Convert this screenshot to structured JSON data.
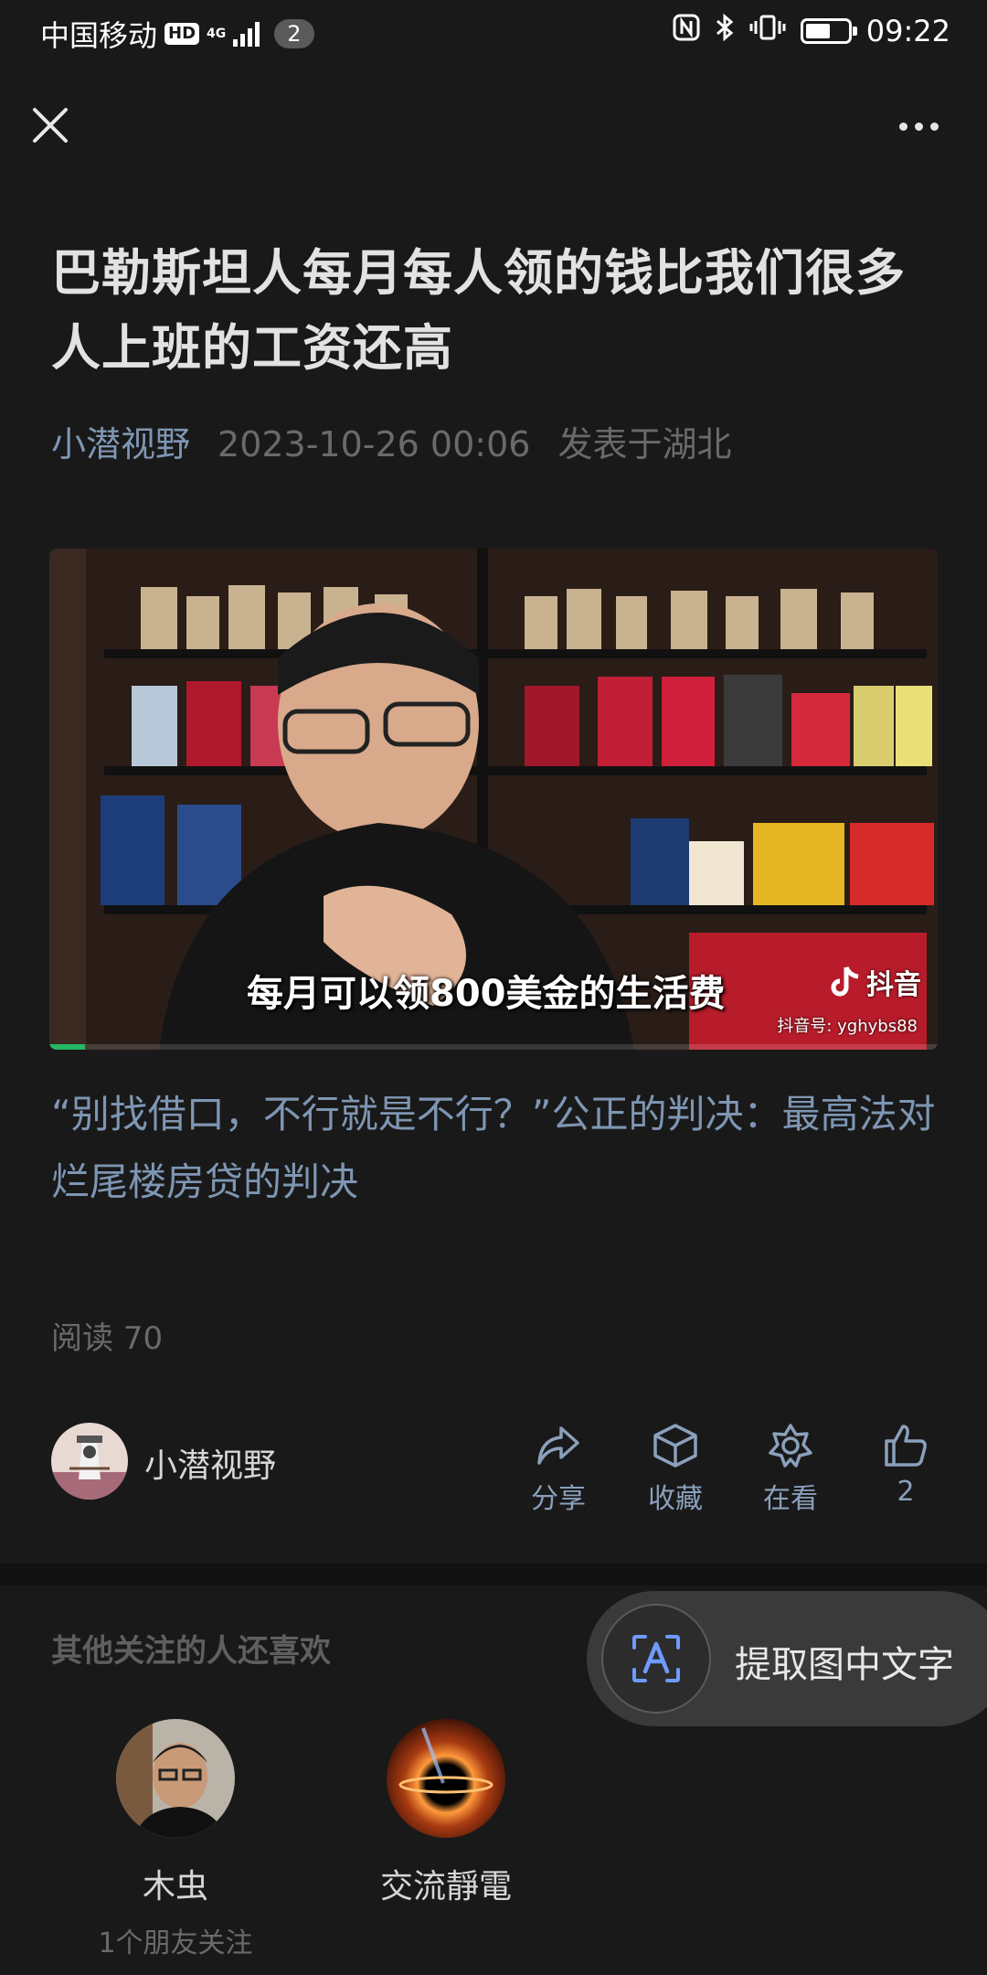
{
  "status_bar": {
    "carrier": "中国移动",
    "hd": "HD",
    "network": "4G",
    "badge": "2",
    "nfc": "N",
    "time": "09:22"
  },
  "article": {
    "title": "巴勒斯坦人每月每人领的钱比我们很多人上班的工资还高",
    "author": "小潜视野",
    "date": "2023-10-26 00:06",
    "location": "发表于湖北",
    "video": {
      "subtitle": "每月可以领800美金的生活费",
      "platform": "抖音",
      "account": "抖音号: yghybs88",
      "progress": 0.04
    },
    "caption": "“别找借口，不行就是不行？”公正的判决：最高法对烂尾楼房贷的判决",
    "reads": "阅读 70"
  },
  "footer_bar": {
    "author_name": "小潜视野",
    "actions": [
      {
        "icon": "share-icon",
        "label": "分享"
      },
      {
        "icon": "collect-icon",
        "label": "收藏"
      },
      {
        "icon": "wow-icon",
        "label": "在看"
      },
      {
        "icon": "like-icon",
        "label": "2"
      }
    ]
  },
  "recommend": {
    "title": "其他关注的人还喜欢",
    "extract_button": "提取图中文字",
    "users": [
      {
        "name": "木虫",
        "sub": "1个朋友关注"
      },
      {
        "name": "交流靜電",
        "sub": ""
      }
    ]
  },
  "colors": {
    "background": "#191919",
    "link": "#7e96b3",
    "muted": "#6a6a6a"
  }
}
